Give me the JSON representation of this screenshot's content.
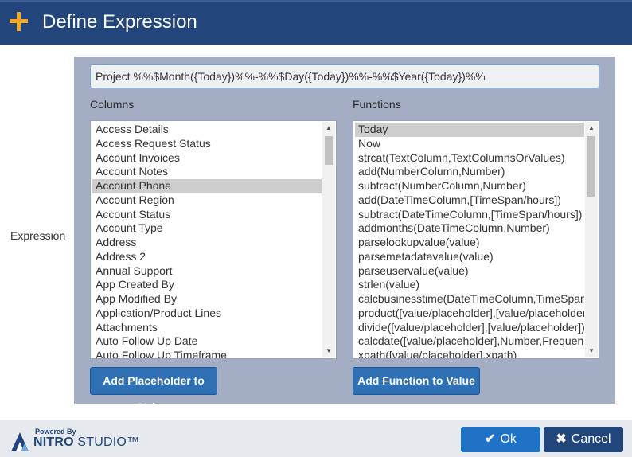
{
  "dialog": {
    "title": "Define Expression",
    "header_icon": "plus-icon",
    "expression_label": "Expression"
  },
  "expression": {
    "value": "Project %%$Month({Today})%%-%%$Day({Today})%%-%%$Year({Today})%%"
  },
  "columns": {
    "heading": "Columns",
    "selected": "Account Phone",
    "items": [
      "Access Details",
      "Access Request Status",
      "Account Invoices",
      "Account Notes",
      "Account Phone",
      "Account Region",
      "Account Status",
      "Account Type",
      "Address",
      "Address 2",
      "Annual Support",
      "App Created By",
      "App Modified By",
      "Application/Product Lines",
      "Attachments",
      "Auto Follow Up Date",
      "Auto Follow Up Timeframe"
    ],
    "add_button_label": "Add Placeholder to Value"
  },
  "functions": {
    "heading": "Functions",
    "selected": "Today",
    "items": [
      "Today",
      "Now",
      "strcat(TextColumn,TextColumnsOrValues)",
      "add(NumberColumn,Number)",
      "subtract(NumberColumn,Number)",
      "add(DateTimeColumn,[TimeSpan/hours])",
      "subtract(DateTimeColumn,[TimeSpan/hours])",
      "addmonths(DateTimeColumn,Number)",
      "parselookupvalue(value)",
      "parsemetadatavalue(value)",
      "parseuservalue(value)",
      "strlen(value)",
      "calcbusinesstime(DateTimeColumn,TimeSpan",
      "product([value/placeholder],[value/placeholder",
      "divide([value/placeholder],[value/placeholder])",
      "calcdate([value/placeholder],Number,Frequenc",
      "xpath([value/placeholder],xpath)"
    ],
    "add_button_label": "Add Function to Value"
  },
  "footer": {
    "powered_by": "Powered By",
    "brand_bold": "NITRO",
    "brand_light": " STUDIO™",
    "ok_label": "Ok",
    "ok_icon": "check-icon",
    "cancel_label": "Cancel",
    "cancel_icon": "close-icon"
  },
  "colors": {
    "header_bg": "#22467c",
    "accent_plus": "#f5a623",
    "panel_bg": "#a3adc4",
    "button_blue": "#2f6fb3",
    "ok_blue": "#1f72c6",
    "cancel_navy": "#22467c"
  }
}
